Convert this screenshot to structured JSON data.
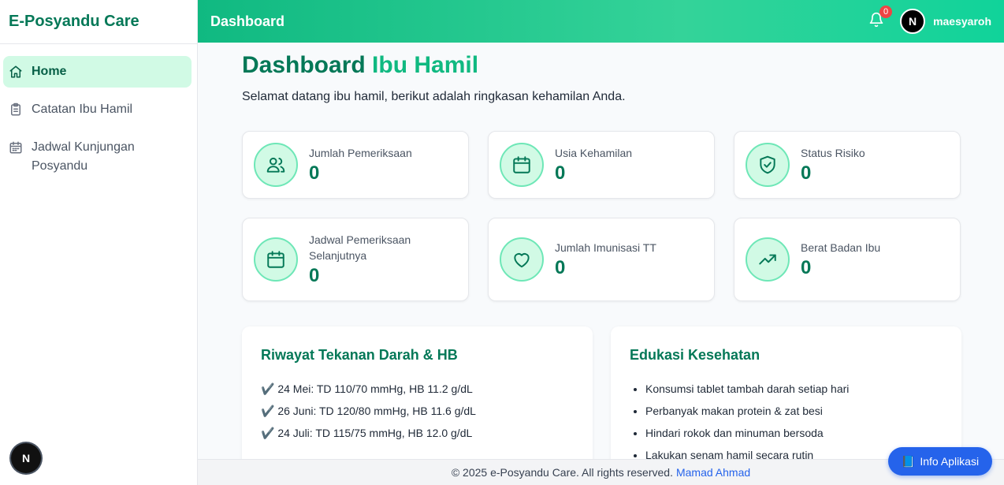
{
  "sidebar": {
    "brand": "E-Posyandu Care",
    "items": [
      {
        "label": "Home",
        "icon": "home-icon",
        "active": true
      },
      {
        "label": "Catatan Ibu Hamil",
        "icon": "clipboard-icon",
        "active": false
      },
      {
        "label": "Jadwal Kunjungan Posyandu",
        "icon": "calendar-icon",
        "active": false
      }
    ],
    "avatar_letter": "N"
  },
  "topbar": {
    "title": "Dashboard",
    "notification_count": "0",
    "avatar_letter": "N",
    "username": "maesyaroh"
  },
  "main": {
    "title_part1": "Dashboard",
    "title_part2": "Ibu Hamil",
    "subtitle": "Selamat datang ibu hamil, berikut adalah ringkasan kehamilan Anda.",
    "cards": [
      {
        "label": "Jumlah Pemeriksaan",
        "value": "0",
        "icon": "users-icon"
      },
      {
        "label": "Usia Kehamilan",
        "value": "0",
        "icon": "calendar-icon"
      },
      {
        "label": "Status Risiko",
        "value": "0",
        "icon": "shield-check-icon"
      },
      {
        "label": "Jadwal Pemeriksaan Selanjutnya",
        "value": "0",
        "icon": "calendar-icon"
      },
      {
        "label": "Jumlah Imunisasi TT",
        "value": "0",
        "icon": "heart-icon"
      },
      {
        "label": "Berat Badan Ibu",
        "value": "0",
        "icon": "trending-up-icon"
      }
    ],
    "history": {
      "title": "Riwayat Tekanan Darah & HB",
      "items": [
        "✔️ 24 Mei: TD 110/70 mmHg, HB 11.2 g/dL",
        "✔️ 26 Juni: TD 120/80 mmHg, HB 11.6 g/dL",
        "✔️ 24 Juli: TD 115/75 mmHg, HB 12.0 g/dL"
      ]
    },
    "education": {
      "title": "Edukasi Kesehatan",
      "items": [
        "Konsumsi tablet tambah darah setiap hari",
        "Perbanyak makan protein & zat besi",
        "Hindari rokok dan minuman bersoda",
        "Lakukan senam hamil secara rutin"
      ]
    }
  },
  "footer": {
    "text": "© 2025 e-Posyandu Care. All rights reserved.",
    "author": "Mamad Ahmad"
  },
  "info_button": {
    "icon": "📘",
    "label": "Info Aplikasi"
  },
  "colors": {
    "primary": "#10b981",
    "primary_dark": "#047857",
    "accent_blue": "#2563eb"
  }
}
